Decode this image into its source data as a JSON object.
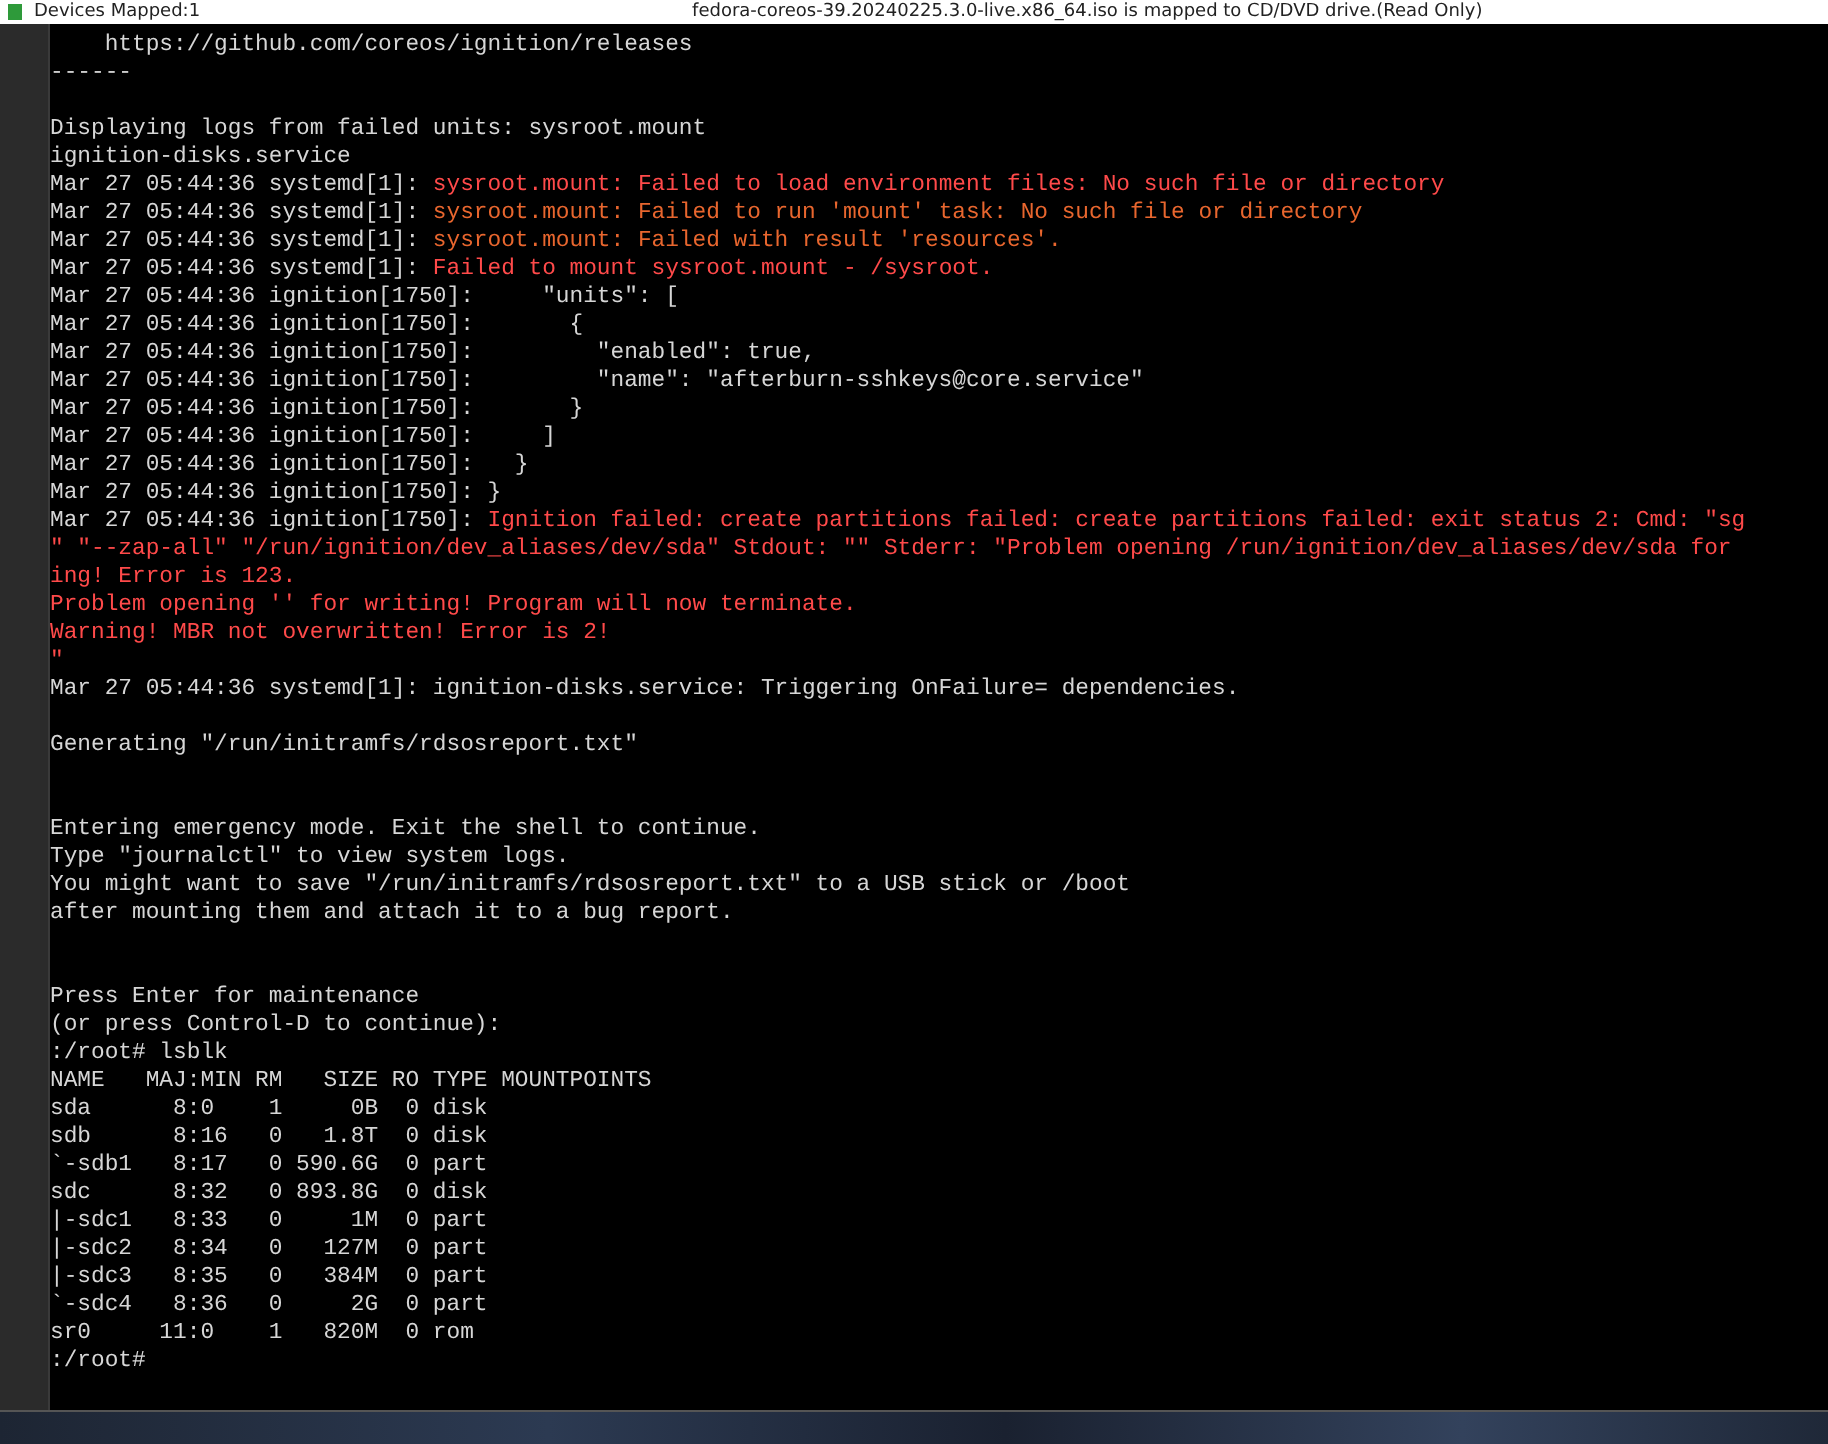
{
  "top_bar": {
    "devices": "Devices Mapped:1",
    "media_notice": "fedora-coreos-39.20240225.3.0-live.x86_64.iso is mapped to CD/DVD drive.(Read Only)"
  },
  "terminal": {
    "lines": [
      {
        "segments": [
          {
            "text": "    https://github.com/coreos/ignition/releases",
            "kind": "plain"
          }
        ]
      },
      {
        "segments": [
          {
            "text": "------",
            "kind": "plain"
          }
        ]
      },
      {
        "gap_before": true,
        "segments": [
          {
            "text": "Displaying logs from failed units: sysroot.mount",
            "kind": "plain"
          }
        ]
      },
      {
        "segments": [
          {
            "text": "ignition-disks.service",
            "kind": "plain"
          }
        ]
      },
      {
        "segments": [
          {
            "text": "Mar 27 05:44:36 systemd[1]: ",
            "kind": "plain"
          },
          {
            "text": "sysroot.mount: Failed to load environment files: No such file or directory",
            "kind": "error"
          }
        ]
      },
      {
        "segments": [
          {
            "text": "Mar 27 05:44:36 systemd[1]: ",
            "kind": "plain"
          },
          {
            "text": "sysroot.mount: Failed to run 'mount' task: No such file or directory",
            "kind": "warning"
          }
        ]
      },
      {
        "segments": [
          {
            "text": "Mar 27 05:44:36 systemd[1]: ",
            "kind": "plain"
          },
          {
            "text": "sysroot.mount: Failed with result 'resources'.",
            "kind": "warning"
          }
        ]
      },
      {
        "segments": [
          {
            "text": "Mar 27 05:44:36 systemd[1]: ",
            "kind": "plain"
          },
          {
            "text": "Failed to mount sysroot.mount - /sysroot.",
            "kind": "error"
          }
        ]
      },
      {
        "segments": [
          {
            "text": "Mar 27 05:44:36 ignition[1750]:     \"units\": [",
            "kind": "plain"
          }
        ]
      },
      {
        "segments": [
          {
            "text": "Mar 27 05:44:36 ignition[1750]:       {",
            "kind": "plain"
          }
        ]
      },
      {
        "segments": [
          {
            "text": "Mar 27 05:44:36 ignition[1750]:         \"enabled\": true,",
            "kind": "plain"
          }
        ]
      },
      {
        "segments": [
          {
            "text": "Mar 27 05:44:36 ignition[1750]:         \"name\": \"afterburn-sshkeys@core.service\"",
            "kind": "plain"
          }
        ]
      },
      {
        "segments": [
          {
            "text": "Mar 27 05:44:36 ignition[1750]:       }",
            "kind": "plain"
          }
        ]
      },
      {
        "segments": [
          {
            "text": "Mar 27 05:44:36 ignition[1750]:     ]",
            "kind": "plain"
          }
        ]
      },
      {
        "segments": [
          {
            "text": "Mar 27 05:44:36 ignition[1750]:   }",
            "kind": "plain"
          }
        ]
      },
      {
        "segments": [
          {
            "text": "Mar 27 05:44:36 ignition[1750]: }",
            "kind": "plain"
          }
        ]
      },
      {
        "segments": [
          {
            "text": "Mar 27 05:44:36 ignition[1750]: ",
            "kind": "plain"
          },
          {
            "text": "Ignition failed: create partitions failed: create partitions failed: exit status 2: Cmd: \"sg",
            "kind": "error"
          }
        ]
      },
      {
        "segments": [
          {
            "text": "\" \"--zap-all\" \"/run/ignition/dev_aliases/dev/sda\" Stdout: \"\" Stderr: \"Problem opening /run/ignition/dev_aliases/dev/sda for",
            "kind": "error"
          }
        ]
      },
      {
        "segments": [
          {
            "text": "ing! Error is 123.",
            "kind": "error"
          }
        ]
      },
      {
        "segments": [
          {
            "text": "Problem opening '' for writing! Program will now terminate.",
            "kind": "error"
          }
        ]
      },
      {
        "segments": [
          {
            "text": "Warning! MBR not overwritten! Error is 2!",
            "kind": "error"
          }
        ]
      },
      {
        "segments": [
          {
            "text": "\"",
            "kind": "error"
          }
        ]
      },
      {
        "segments": [
          {
            "text": "Mar 27 05:44:36 systemd[1]: ignition-disks.service: Triggering OnFailure= dependencies.",
            "kind": "plain"
          }
        ]
      },
      {
        "gap_before": true,
        "segments": [
          {
            "text": "Generating \"/run/initramfs/rdsosreport.txt\"",
            "kind": "plain"
          }
        ]
      },
      {
        "wide_gap_before": true,
        "segments": [
          {
            "text": "Entering emergency mode. Exit the shell to continue.",
            "kind": "plain"
          }
        ]
      },
      {
        "segments": [
          {
            "text": "Type \"journalctl\" to view system logs.",
            "kind": "plain"
          }
        ]
      },
      {
        "segments": [
          {
            "text": "You might want to save \"/run/initramfs/rdsosreport.txt\" to a USB stick or /boot",
            "kind": "plain"
          }
        ]
      },
      {
        "segments": [
          {
            "text": "after mounting them and attach it to a bug report.",
            "kind": "plain"
          }
        ]
      },
      {
        "wide_gap_before": true,
        "segments": [
          {
            "text": "Press Enter for maintenance",
            "kind": "plain"
          }
        ]
      },
      {
        "segments": [
          {
            "text": "(or press Control-D to continue):",
            "kind": "plain"
          }
        ]
      },
      {
        "segments": [
          {
            "text": ":/root# lsblk",
            "kind": "plain"
          }
        ]
      },
      {
        "segments": [
          {
            "text": "NAME   MAJ:MIN RM   SIZE RO TYPE MOUNTPOINTS",
            "kind": "plain"
          }
        ]
      },
      {
        "segments": [
          {
            "text": "sda      8:0    1     0B  0 disk",
            "kind": "plain"
          }
        ]
      },
      {
        "segments": [
          {
            "text": "sdb      8:16   0   1.8T  0 disk",
            "kind": "plain"
          }
        ]
      },
      {
        "segments": [
          {
            "text": "`-sdb1   8:17   0 590.6G  0 part",
            "kind": "plain"
          }
        ]
      },
      {
        "segments": [
          {
            "text": "sdc      8:32   0 893.8G  0 disk",
            "kind": "plain"
          }
        ]
      },
      {
        "segments": [
          {
            "text": "|-sdc1   8:33   0     1M  0 part",
            "kind": "plain"
          }
        ]
      },
      {
        "segments": [
          {
            "text": "|-sdc2   8:34   0   127M  0 part",
            "kind": "plain"
          }
        ]
      },
      {
        "segments": [
          {
            "text": "|-sdc3   8:35   0   384M  0 part",
            "kind": "plain"
          }
        ]
      },
      {
        "segments": [
          {
            "text": "`-sdc4   8:36   0     2G  0 part",
            "kind": "plain"
          }
        ]
      },
      {
        "segments": [
          {
            "text": "sr0     11:0    1   820M  0 rom",
            "kind": "plain"
          }
        ]
      },
      {
        "segments": [
          {
            "text": ":/root#",
            "kind": "plain"
          }
        ]
      }
    ]
  }
}
